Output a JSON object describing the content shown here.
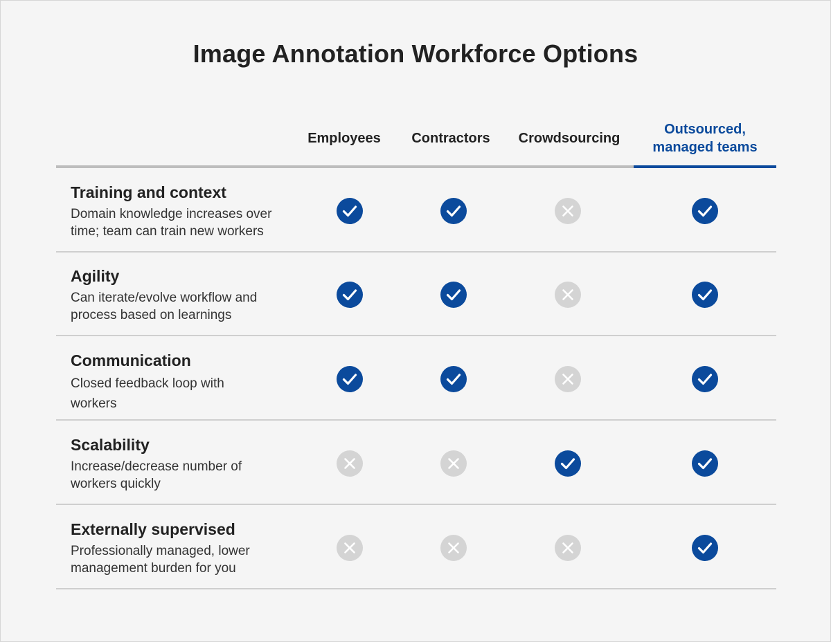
{
  "title": "Image Annotation Workforce Options",
  "colors": {
    "accent": "#0b4a9c",
    "check_fill": "#0b4a9c",
    "cross_fill": "#d4d4d4",
    "background": "#f5f5f5"
  },
  "icons": {
    "yes": "check-circle-icon",
    "no": "x-circle-icon"
  },
  "columns": [
    {
      "key": "employees",
      "label": "Employees",
      "highlight": false
    },
    {
      "key": "contractors",
      "label": "Contractors",
      "highlight": false
    },
    {
      "key": "crowdsourcing",
      "label": "Crowdsourcing",
      "highlight": false
    },
    {
      "key": "outsourced",
      "label_line1": "Outsourced,",
      "label_line2": "managed teams",
      "highlight": true
    }
  ],
  "rows": [
    {
      "title": "Training and context",
      "desc_line1": "Domain knowledge increases over",
      "desc_line2": "time; team can train new workers",
      "values": [
        true,
        true,
        false,
        true
      ]
    },
    {
      "title": "Agility",
      "desc_line1": "Can iterate/evolve workflow and",
      "desc_line2": "process based on learnings",
      "values": [
        true,
        true,
        false,
        true
      ]
    },
    {
      "title": "Communication",
      "desc_line1": "Closed feedback loop with",
      "desc_line2": "workers",
      "values": [
        true,
        true,
        false,
        true
      ]
    },
    {
      "title": "Scalability",
      "desc_line1": "Increase/decrease number of",
      "desc_line2": "workers quickly",
      "values": [
        false,
        false,
        true,
        true
      ]
    },
    {
      "title": "Externally supervised",
      "desc_line1": "Professionally managed, lower",
      "desc_line2": "management burden for you",
      "values": [
        false,
        false,
        false,
        true
      ]
    }
  ]
}
